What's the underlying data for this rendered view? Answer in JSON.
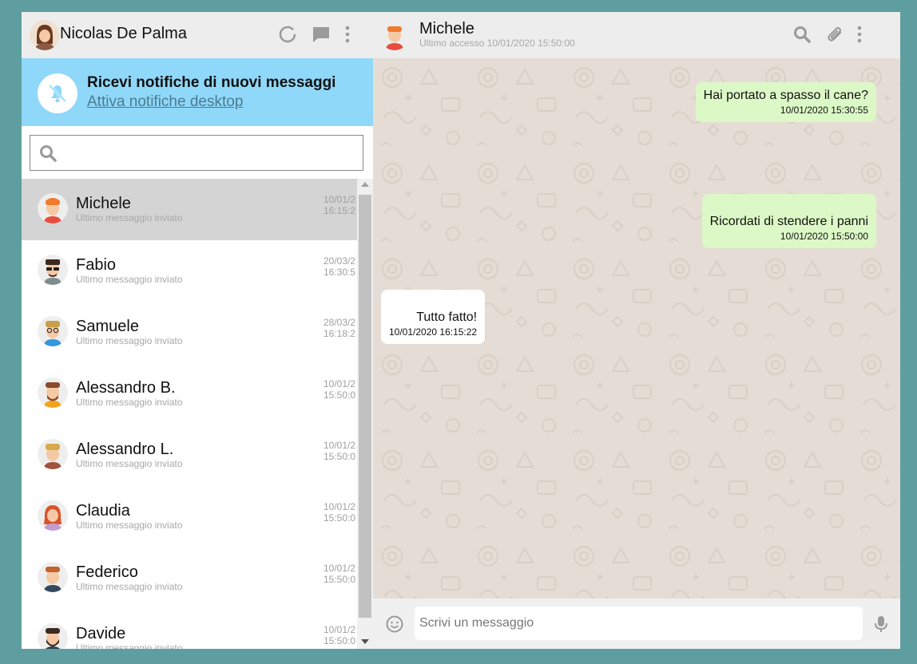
{
  "user": {
    "name": "Nicolas De Palma"
  },
  "notification": {
    "title": "Ricevi notifiche di nuovi messaggi",
    "link": "Attiva notifiche desktop"
  },
  "search": {
    "placeholder": "",
    "value": ""
  },
  "contacts": [
    {
      "name": "Michele",
      "last_message": "Ultimo messaggio inviato",
      "date": "10/01/2",
      "time": "16:15:2",
      "active": true
    },
    {
      "name": "Fabio",
      "last_message": "Ultimo messaggio inviato",
      "date": "20/03/2",
      "time": "16:30:5"
    },
    {
      "name": "Samuele",
      "last_message": "Ultimo messaggio inviato",
      "date": "28/03/2",
      "time": "16:18:2"
    },
    {
      "name": "Alessandro B.",
      "last_message": "Ultimo messaggio inviato",
      "date": "10/01/2",
      "time": "15:50:0"
    },
    {
      "name": "Alessandro L.",
      "last_message": "Ultimo messaggio inviato",
      "date": "10/01/2",
      "time": "15:50:0"
    },
    {
      "name": "Claudia",
      "last_message": "Ultimo messaggio inviato",
      "date": "10/01/2",
      "time": "15:50:0"
    },
    {
      "name": "Federico",
      "last_message": "Ultimo messaggio inviato",
      "date": "10/01/2",
      "time": "15:50:0"
    },
    {
      "name": "Davide",
      "last_message": "Ultimo messaggio inviato",
      "date": "10/01/2",
      "time": "15:50:0"
    }
  ],
  "chat": {
    "peer_name": "Michele",
    "peer_status": "Ultimo accesso 10/01/2020 15:50:00",
    "messages": [
      {
        "direction": "sent",
        "text": "Hai portato a spasso il cane?",
        "time": "10/01/2020 15:30:55"
      },
      {
        "direction": "sent",
        "text": "Ricordati di stendere i panni",
        "time": "10/01/2020 15:50:00"
      },
      {
        "direction": "received",
        "text": "Tutto fatto!",
        "time": "10/01/2020 16:15:22"
      }
    ]
  },
  "composer": {
    "placeholder": "Scrivi un messaggio"
  },
  "colors": {
    "page_bg": "#5f9ea0",
    "header_bg": "#ededed",
    "notification_bg": "#8fd8fa",
    "active_contact_bg": "#d4d4d4",
    "chat_bg": "#e5ddd5",
    "sent_bubble": "#dcf8c6",
    "received_bubble": "#ffffff"
  },
  "icons": {
    "header_left": [
      "status-ring-icon",
      "chat-icon",
      "menu-dots-icon"
    ],
    "header_right": [
      "search-icon",
      "attach-icon",
      "menu-dots-icon"
    ],
    "notification": "bell-off-icon",
    "composer": [
      "emoji-icon",
      "mic-icon"
    ]
  }
}
